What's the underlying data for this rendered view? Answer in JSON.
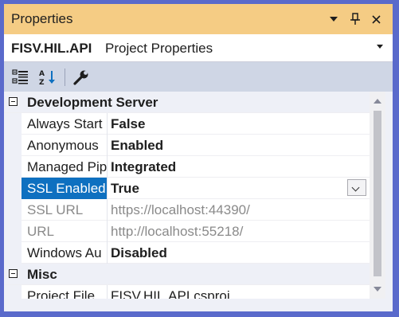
{
  "window": {
    "title": "Properties",
    "buttons": {
      "dropdown": "▾",
      "pin": "📌",
      "close": "✕"
    }
  },
  "object_selector": {
    "name": "FISV.HIL.API",
    "type": "Project Properties"
  },
  "toolbar": {
    "items": [
      "categorized-icon",
      "alphabetical-icon",
      "property-pages-icon"
    ]
  },
  "grid": {
    "categories": [
      {
        "label": "Development Server",
        "properties": [
          {
            "name": "Always Start",
            "value": "False"
          },
          {
            "name": "Anonymous",
            "value": "Enabled"
          },
          {
            "name": "Managed Pip",
            "value": "Integrated"
          },
          {
            "name": "SSL Enabled",
            "value": "True",
            "selected": true
          },
          {
            "name": "SSL URL",
            "value": "https://localhost:44390/",
            "readonly": true
          },
          {
            "name": "URL",
            "value": "http://localhost:55218/",
            "readonly": true
          },
          {
            "name": "Windows Au",
            "value": "Disabled"
          }
        ]
      },
      {
        "label": "Misc",
        "properties": [
          {
            "name": "Project File",
            "value": "FISV.HIL.API.csproj"
          }
        ]
      }
    ]
  },
  "colors": {
    "title_bar": "#F5CC84",
    "selection": "#0E70C0",
    "frame": "#5A6ACB"
  }
}
